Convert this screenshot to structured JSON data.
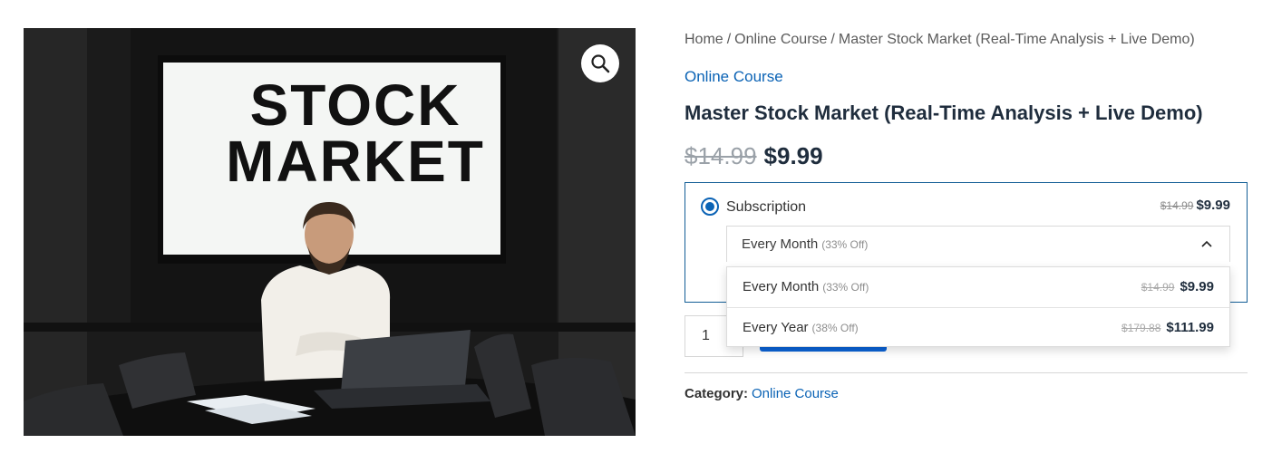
{
  "image": {
    "sign_line1": "STOCK",
    "sign_line2": "MARKET",
    "zoom_icon": "magnifier-icon"
  },
  "breadcrumb": {
    "items": [
      "Home",
      "Online Course",
      "Master Stock Market (Real-Time Analysis + Live Demo)"
    ],
    "separator": "/"
  },
  "product": {
    "category_link": "Online Course",
    "title": "Master Stock Market (Real-Time Analysis + Live Demo)",
    "price_old": "$14.99",
    "price_new": "$9.99"
  },
  "subscription": {
    "label": "Subscription",
    "price_old": "$14.99",
    "price_new": "$9.99",
    "selected_value": "Every Month",
    "selected_off": "(33% Off)",
    "options": [
      {
        "label": "Every Month",
        "off": "(33% Off)",
        "price_old": "$14.99",
        "price_new": "$9.99"
      },
      {
        "label": "Every Year",
        "off": "(38% Off)",
        "price_old": "$179.88",
        "price_new": "$111.99"
      }
    ]
  },
  "cart": {
    "quantity": "1",
    "add_label": ""
  },
  "meta": {
    "category_key": "Category:",
    "category_value": "Online Course"
  },
  "colors": {
    "accent": "#0b63b5",
    "button": "#0b63d6",
    "title": "#1f2d3d",
    "box_border": "#135e96"
  }
}
